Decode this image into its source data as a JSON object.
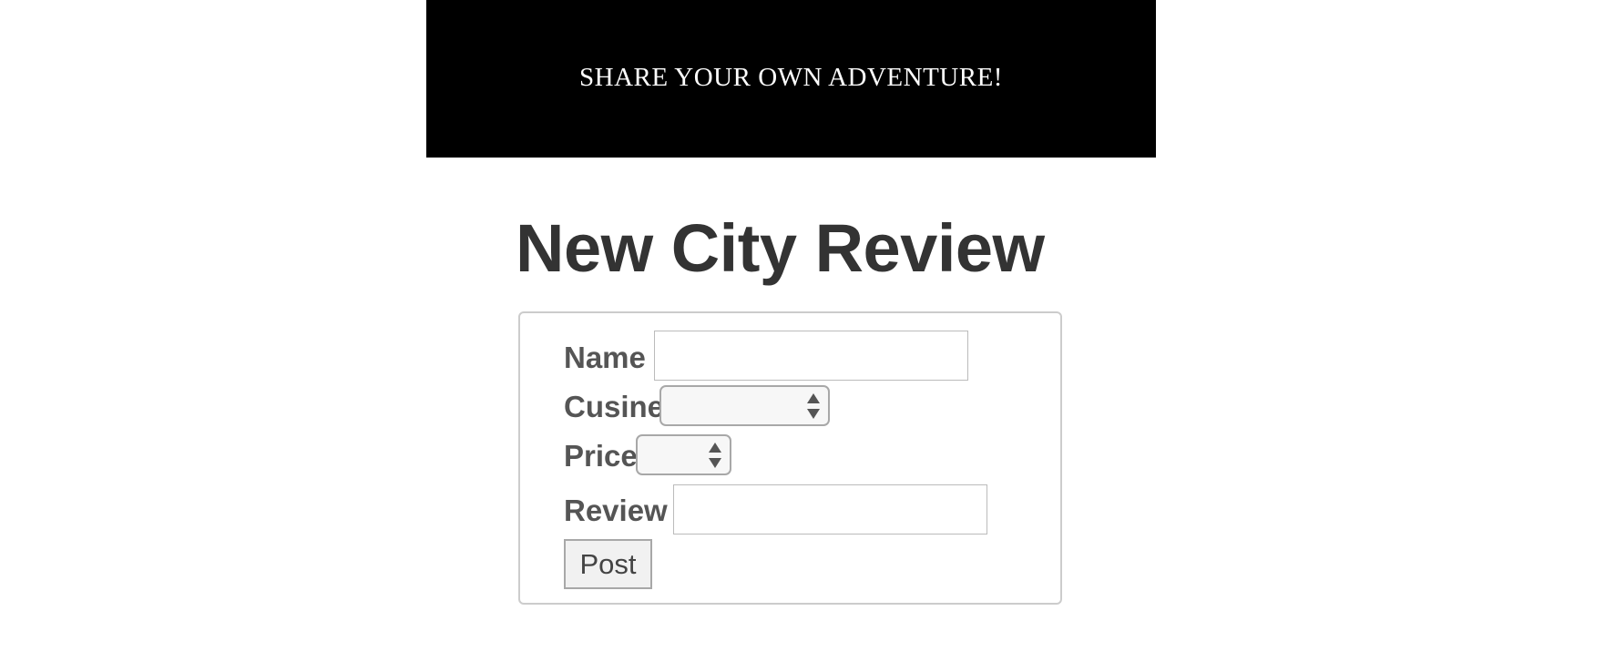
{
  "banner": {
    "text": "SHARE YOUR OWN ADVENTURE!"
  },
  "page": {
    "title": "New City Review"
  },
  "form": {
    "fields": {
      "name": {
        "label": "Name",
        "value": ""
      },
      "cuisine": {
        "label": "Cusine",
        "selected": ""
      },
      "price": {
        "label": "Price",
        "selected": ""
      },
      "review": {
        "label": "Review",
        "value": ""
      }
    },
    "submit_label": "Post"
  },
  "icons": {
    "select_arrow": "select-arrows-icon"
  },
  "colors": {
    "banner_bg": "#000000",
    "banner_text": "#ffffff",
    "title_text": "#333333",
    "label_text": "#555555",
    "panel_border": "#cccccc"
  }
}
